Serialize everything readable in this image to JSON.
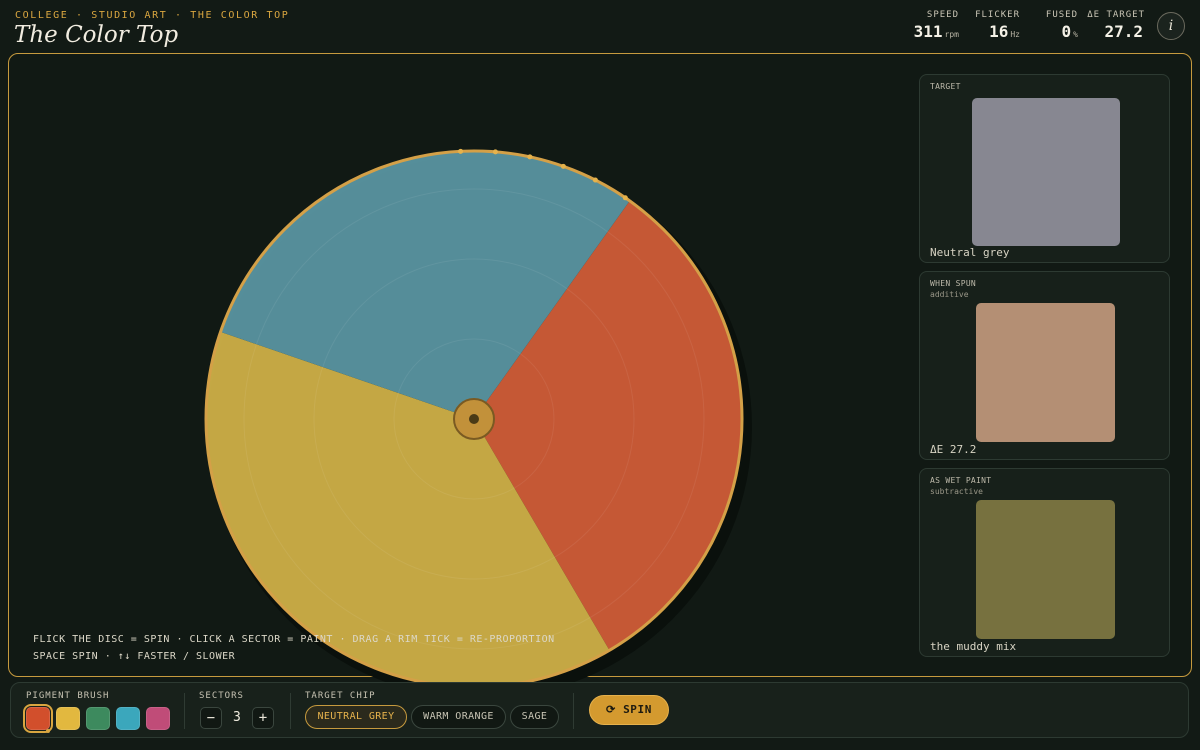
{
  "header": {
    "breadcrumb": "COLLEGE · STUDIO ART · THE COLOR TOP",
    "title": "The Color Top",
    "stats": [
      {
        "label": "SPEED",
        "value": "311",
        "unit": "rpm"
      },
      {
        "label": "FLICKER",
        "value": "16",
        "unit": "Hz"
      },
      {
        "label": "FUSED",
        "value": "0",
        "unit": "%"
      },
      {
        "label": "ΔE TARGET",
        "value": "27.2",
        "unit": ""
      }
    ],
    "info_icon": "i"
  },
  "disc": {
    "sectors": [
      {
        "color": "#d9603a",
        "share": 0.317
      },
      {
        "color": "#d8b84a",
        "share": 0.387
      },
      {
        "color": "#5d9ba8",
        "share": 0.296
      }
    ],
    "rim_color": "#d4a047",
    "hub_color": "#c2913a"
  },
  "hints": [
    "FLICK THE DISC = SPIN · CLICK A SECTOR = PAINT · DRAG A RIM TICK = RE-PROPORTION",
    "SPACE SPIN · ↑↓ FASTER / SLOWER"
  ],
  "cards": {
    "target": {
      "label": "TARGET",
      "sublabel": "",
      "footer": "Neutral grey",
      "color": "#878791"
    },
    "spun": {
      "label": "WHEN SPUN",
      "sublabel": "additive",
      "footer": "ΔE 27.2",
      "color": "#b48f74"
    },
    "wet": {
      "label": "AS WET PAINT",
      "sublabel": "subtractive",
      "footer": "the muddy mix",
      "color": "#77713f"
    }
  },
  "toolbar": {
    "brush_label": "PIGMENT BRUSH",
    "pigments": [
      {
        "name": "red-orange",
        "color": "#d24f2c",
        "selected": true
      },
      {
        "name": "yellow",
        "color": "#e2b83f",
        "selected": false
      },
      {
        "name": "green",
        "color": "#3d8a5e",
        "selected": false
      },
      {
        "name": "cyan",
        "color": "#3ba7bc",
        "selected": false
      },
      {
        "name": "magenta",
        "color": "#c04c78",
        "selected": false
      }
    ],
    "sectors_label": "SECTORS",
    "minus_label": "−",
    "sectors_value": "3",
    "plus_label": "+",
    "chip_label": "TARGET CHIP",
    "chips": [
      {
        "label": "NEUTRAL GREY",
        "active": true
      },
      {
        "label": "WARM ORANGE",
        "active": false
      },
      {
        "label": "SAGE",
        "active": false
      }
    ],
    "spin_label": "⟳ SPIN"
  }
}
